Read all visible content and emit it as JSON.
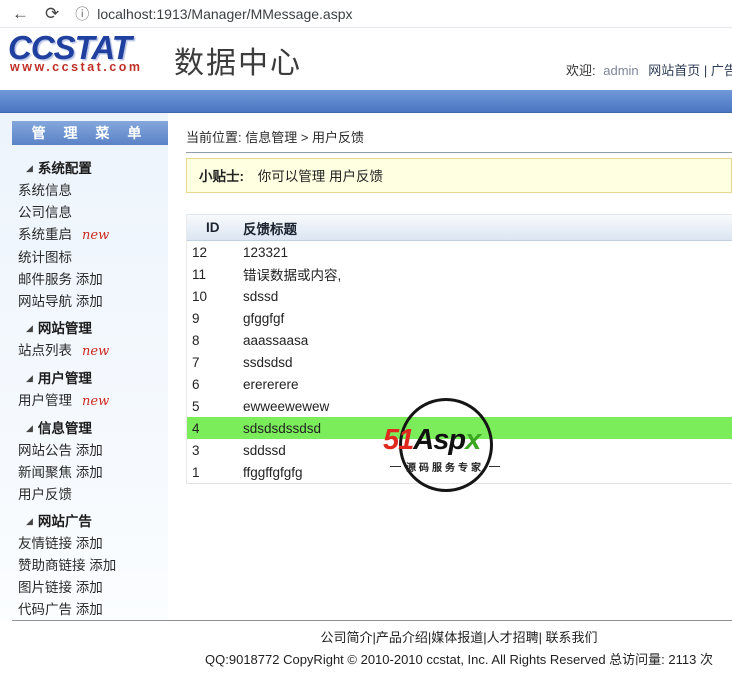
{
  "icons": {
    "back": "←",
    "refresh": "⟳",
    "info": "ⓘ",
    "tree": "◢"
  },
  "browser": {
    "url": "localhost:1913/Manager/MMessage.aspx"
  },
  "header": {
    "logo_main": "CCSTAT",
    "logo_sub": "www.ccstat.com",
    "logo_title": "数据中心",
    "welcome_prefix": "欢迎:",
    "welcome_user": "admin",
    "welcome_links": "网站首页 | 广告"
  },
  "sidebar": {
    "title": "管 理 菜 单",
    "sections": [
      {
        "label": "系统配置",
        "items": [
          {
            "label": "系统信息"
          },
          {
            "label": "公司信息"
          },
          {
            "label": "系统重启",
            "badge": "new"
          },
          {
            "label": "统计图标"
          },
          {
            "label": "邮件服务 添加"
          },
          {
            "label": "网站导航 添加"
          }
        ]
      },
      {
        "label": "网站管理",
        "items": [
          {
            "label": "站点列表",
            "badge": "new"
          }
        ]
      },
      {
        "label": "用户管理",
        "items": [
          {
            "label": "用户管理",
            "badge": "new"
          }
        ]
      },
      {
        "label": "信息管理",
        "items": [
          {
            "label": "网站公告 添加"
          },
          {
            "label": "新闻聚焦 添加"
          },
          {
            "label": "用户反馈"
          }
        ]
      },
      {
        "label": "网站广告",
        "items": [
          {
            "label": "友情链接 添加"
          },
          {
            "label": "赞助商链接 添加"
          },
          {
            "label": "图片链接 添加"
          },
          {
            "label": "代码广告 添加"
          }
        ]
      }
    ]
  },
  "main": {
    "breadcrumb": "当前位置: 信息管理 > 用户反馈",
    "tip_label": "小贴士:",
    "tip_text": "你可以管理 用户反馈",
    "table": {
      "columns": [
        "ID",
        "反馈标题"
      ],
      "rows": [
        {
          "id": "12",
          "title": "123321"
        },
        {
          "id": "11",
          "title": "错误数据或内容,"
        },
        {
          "id": "10",
          "title": "sdssd"
        },
        {
          "id": "9",
          "title": "gfggfgf"
        },
        {
          "id": "8",
          "title": "aaassaasa"
        },
        {
          "id": "7",
          "title": "ssdsdsd"
        },
        {
          "id": "6",
          "title": "erererere"
        },
        {
          "id": "5",
          "title": "ewweewewew"
        },
        {
          "id": "4",
          "title": "sdsdsdssdsd",
          "highlighted": true
        },
        {
          "id": "3",
          "title": "sddssd"
        },
        {
          "id": "1",
          "title": "ffggffgfgfg"
        }
      ]
    },
    "watermark": {
      "part_51": "51",
      "part_asp": "Asp",
      "part_x": "x",
      "tagline": "源码服务专家"
    }
  },
  "footer": {
    "links": "公司简介|产品介绍|媒体报道|人才招聘| 联系我们",
    "copyright": "QQ:9018772 CopyRight © 2010-2010 ccstat, Inc. All Rights Reserved 总访问量: 2113 次"
  },
  "colors": {
    "accent_blue": "#4b76c1",
    "highlight_green": "#7bed5a",
    "new_red": "#cc2a1e"
  }
}
